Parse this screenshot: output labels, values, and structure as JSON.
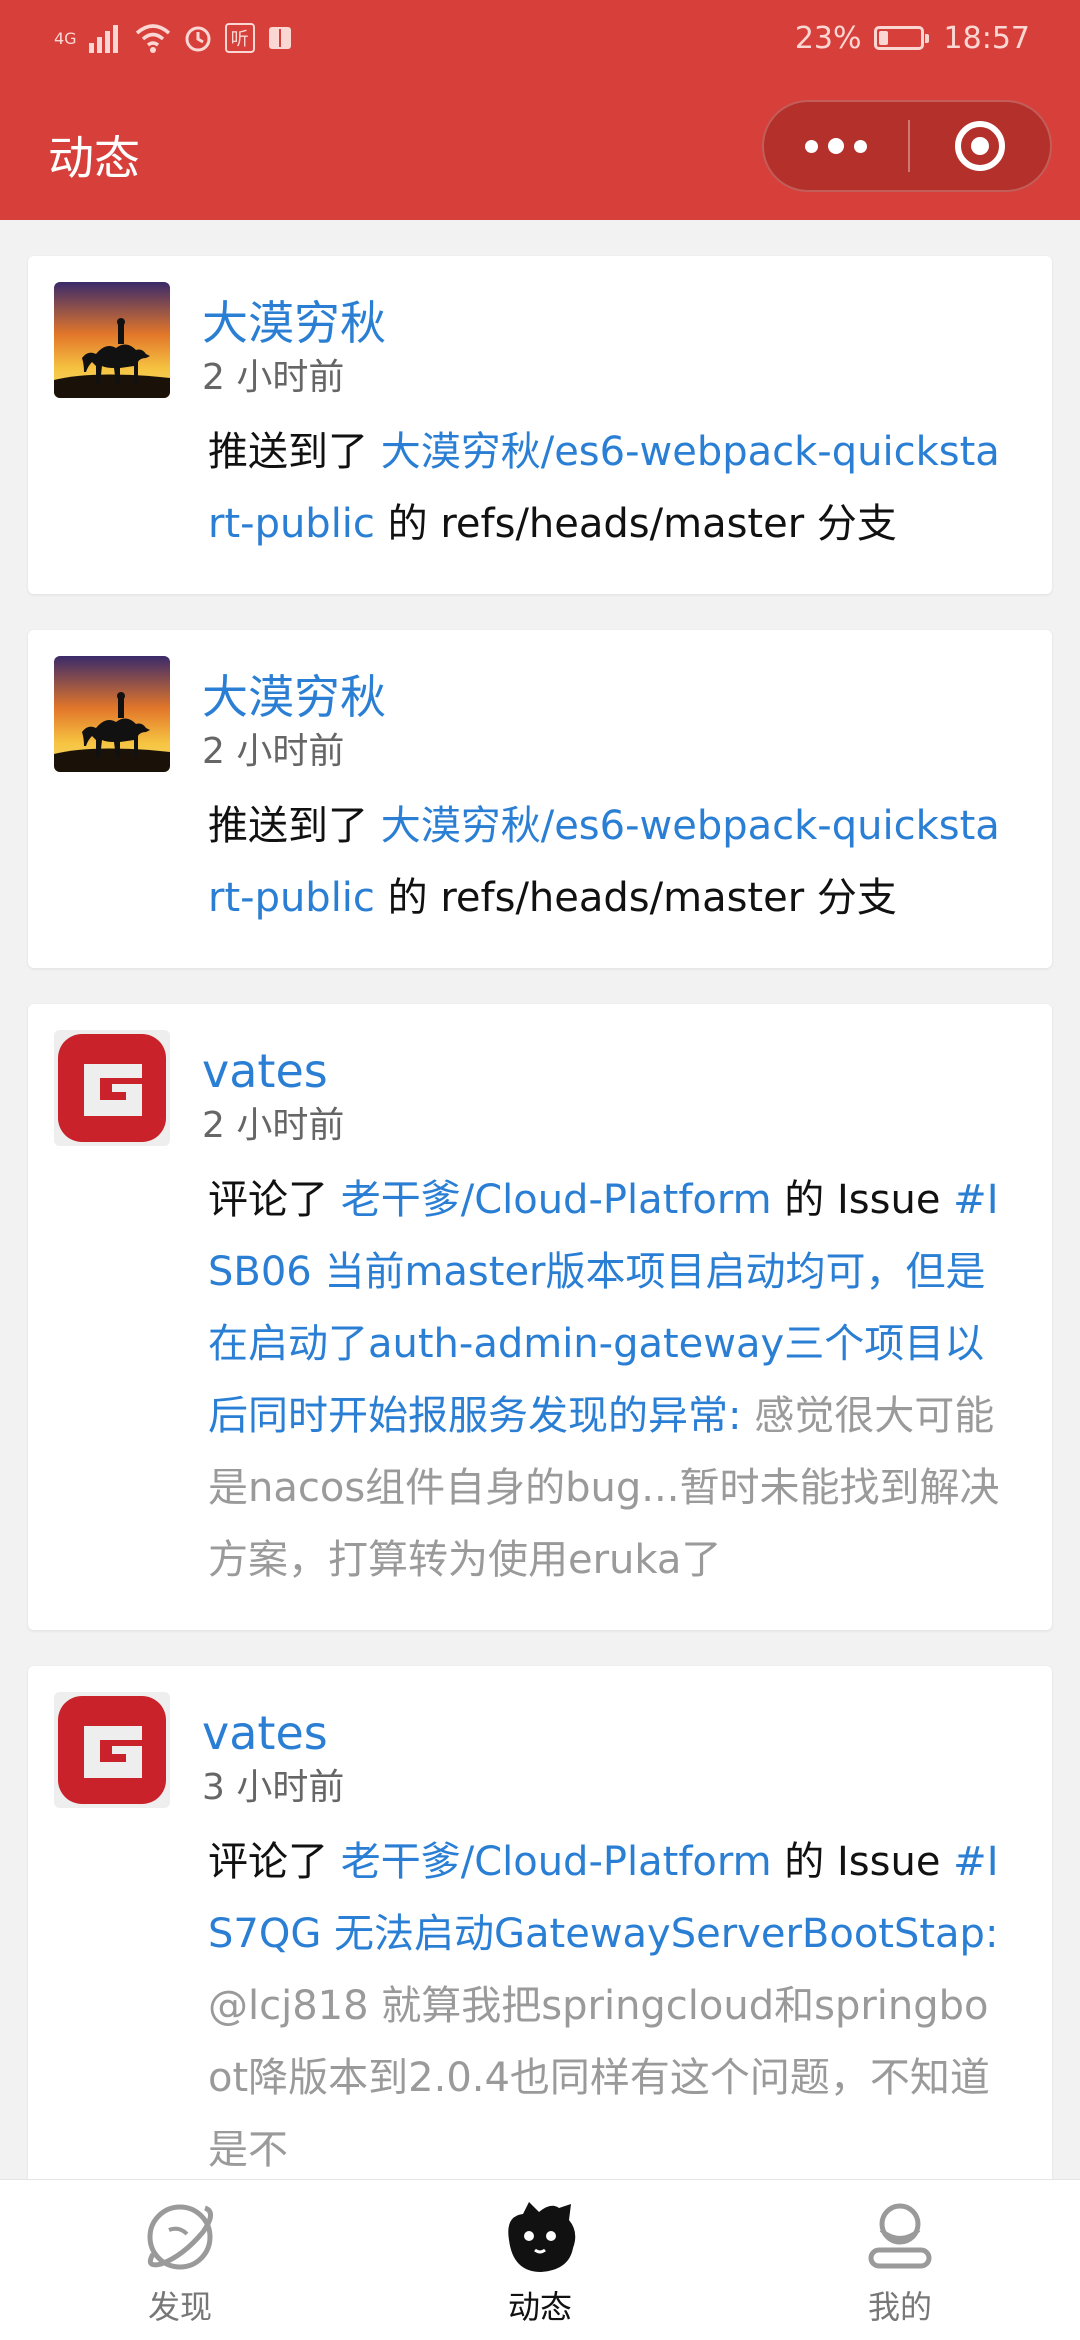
{
  "status_bar": {
    "network": "4G",
    "badge": "听",
    "battery": "23%",
    "battery_level": 0.23,
    "time": "18:57"
  },
  "app_bar": {
    "title": "动态"
  },
  "feed": [
    {
      "username": "大漠穷秋",
      "time": "2 小时前",
      "action": "推送到了 ",
      "repo": "大漠穷秋/es6-webpack-quickstart-public",
      "connector": " 的 refs/heads/master 分支"
    },
    {
      "username": "大漠穷秋",
      "time": "2 小时前",
      "action": "推送到了 ",
      "repo": "大漠穷秋/es6-webpack-quickstart-public",
      "connector": " 的 refs/heads/master 分支"
    },
    {
      "username": "vates",
      "time": "2 小时前",
      "action": "评论了 ",
      "repo": "老干爹/Cloud-Platform",
      "connector": " 的 Issue ",
      "issue": "#ISB06 当前master版本项目启动均可，但是在启动了auth-admin-gateway三个项目以后同时开始报服务发现的异常:",
      "comment": " 感觉很大可能是nacos组件自身的bug...暂时未能找到解决方案，打算转为使用eruka了"
    },
    {
      "username": "vates",
      "time": "3 小时前",
      "action": "评论了 ",
      "repo": "老干爹/Cloud-Platform",
      "connector": " 的 Issue ",
      "issue": "#IS7QG 无法启动GatewayServerBootStap:",
      "comment": " @lcj818 就算我把springcloud和springboot降版本到2.0.4也同样有这个问题，不知道是不"
    }
  ],
  "tab_bar": {
    "tabs": [
      {
        "label": "发现",
        "icon": "planet-icon"
      },
      {
        "label": "动态",
        "icon": "cat-face-icon"
      },
      {
        "label": "我的",
        "icon": "person-icon"
      }
    ],
    "active": "动态"
  },
  "colors": {
    "header": "#d7403a",
    "link": "#2a7fd4",
    "muted": "#9a9a9a"
  }
}
